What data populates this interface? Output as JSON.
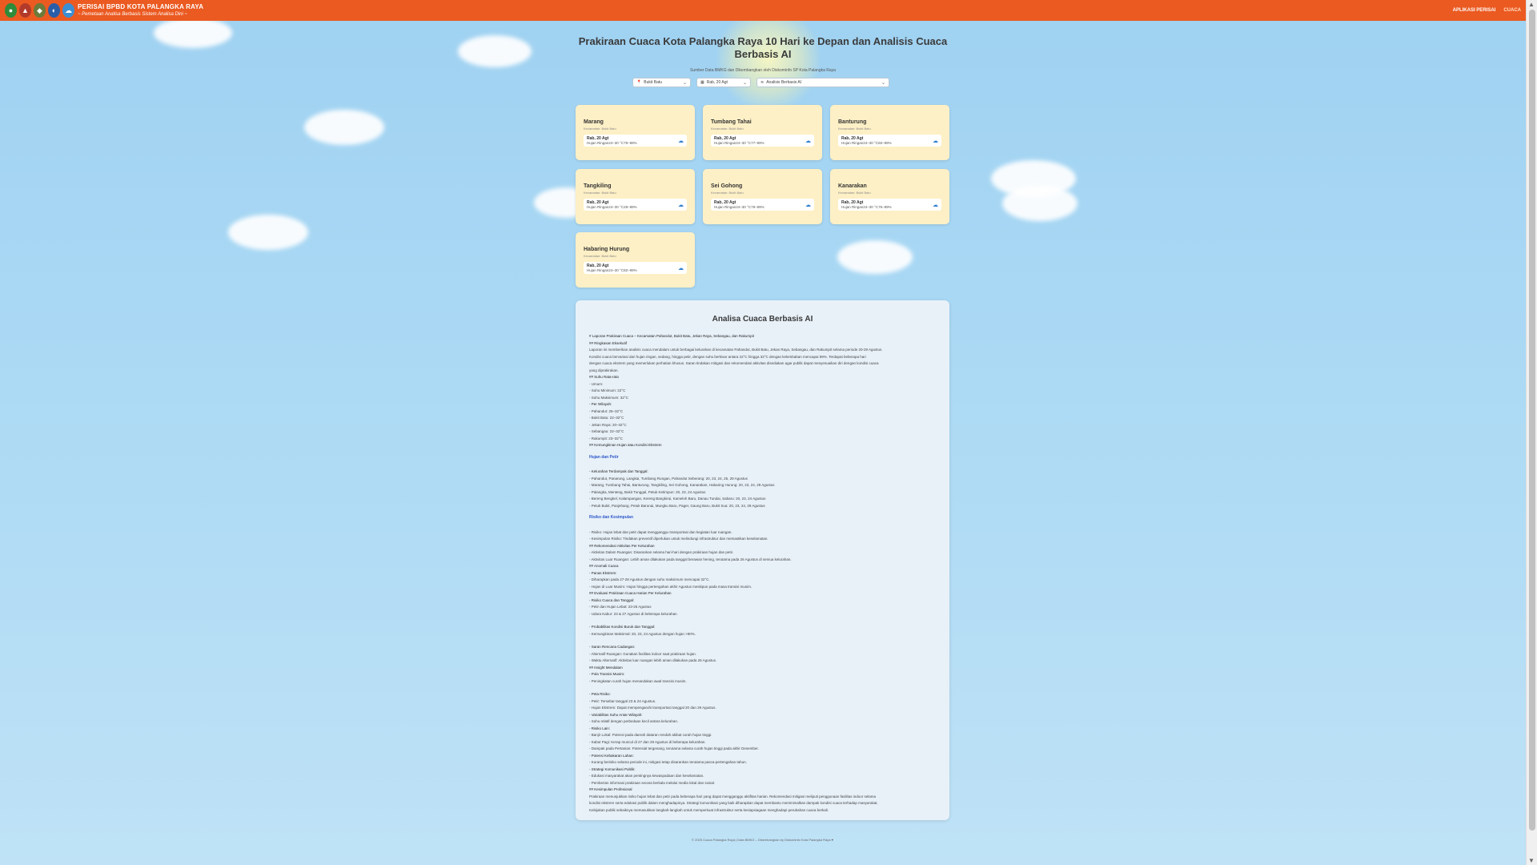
{
  "header": {
    "brand_title": "PERISAI BPBD KOTA PALANGKA RAYA",
    "brand_subtitle": "~ Pemetaan Analisa Berbasis Sistem Analisa Dini ~",
    "nav": [
      "APLIKASI PERISAI",
      "CUACA"
    ],
    "accent": "#eb5a21"
  },
  "main": {
    "title": "Prakiraan Cuaca Kota Palangka Raya 10 Hari ke Depan dan Analisis Cuaca Berbasis AI",
    "subtitle": "Sumber Data BMKG dan Dikembangkan oleh Diskominfo SP Kota Palangka Raya"
  },
  "filters": {
    "location": "Bukit Batu",
    "date": "Rab, 20 Agt",
    "mode": "Analisis Berbasis AI"
  },
  "cards": [
    {
      "name": "Marang",
      "kecamatan": "Kecamatan: Bukit Batu",
      "date": "Rab, 20 Agt",
      "desc": "Hujan Ringan24–30 °C79–99%"
    },
    {
      "name": "Tumbang Tahai",
      "kecamatan": "Kecamatan: Bukit Batu",
      "date": "Rab, 20 Agt",
      "desc": "Hujan Ringan24–30 °C77–99%"
    },
    {
      "name": "Banturung",
      "kecamatan": "Kecamatan: Bukit Batu",
      "date": "Rab, 20 Agt",
      "desc": "Hujan Ringan24–30 °C60–99%"
    },
    {
      "name": "Tangkiling",
      "kecamatan": "Kecamatan: Bukit Batu",
      "date": "Rab, 20 Agt",
      "desc": "Hujan Ringan24–30 °C28–99%"
    },
    {
      "name": "Sei Gohong",
      "kecamatan": "Kecamatan: Bukit Batu",
      "date": "Rab, 20 Agt",
      "desc": "Hujan Ringan24–30 °C79–99%"
    },
    {
      "name": "Kanarakan",
      "kecamatan": "Kecamatan: Bukit Batu",
      "date": "Rab, 20 Agt",
      "desc": "Hujan Ringan24–30 °C76–99%"
    },
    {
      "name": "Habaring Hurung",
      "kecamatan": "Kecamatan: Bukit Batu",
      "date": "Rab, 20 Agt",
      "desc": "Hujan Ringan24–30 °C82–99%"
    }
  ],
  "analysis": {
    "title": "Analisa Cuaca Berbasis AI",
    "lines": [
      {
        "t": "# Laporan Prakiraan Cuaca – Kecamatan Pahandut, Bukit Batu, Jekan Raya, Sebangau, dan Rakumpit",
        "c": "h"
      },
      {
        "t": "## Ringkasan Eksekutif",
        "c": "h"
      },
      {
        "t": "Laporan ini memberikan analisis cuaca mendalam untuk berbagai kelurahan di kecamatan Pahandut, Bukit Batu, Jekan Raya, Sebangau, dan Rakumpit selama periode 20-29 Agustus.",
        "c": ""
      },
      {
        "t": "Kondisi cuaca bervariasi dari hujan ringan, sedang, hingga petir, dengan suhu berkisar antara 22°C hingga 32°C dengan kelembaban mencapai 99%. Terdapat beberapa hari",
        "c": ""
      },
      {
        "t": "dengan cuaca ekstrem yang memerlukan perhatian khusus. Saran tindakan mitigasi dan rekomendasi aktivitas disediakan agar publik dapat menyesuaikan diri dengan kondisi cuaca",
        "c": ""
      },
      {
        "t": "yang diprakirakan.",
        "c": ""
      },
      {
        "t": "## Suhu Rata-rata",
        "c": "h"
      },
      {
        "t": "- Umum:",
        "c": ""
      },
      {
        "t": "  - Suhu Minimum: 22°C",
        "c": ""
      },
      {
        "t": "  - Suhu Maksimum: 32°C",
        "c": ""
      },
      {
        "t": "- Per Wilayah:",
        "c": "h"
      },
      {
        "t": "  - Pahandut: 25–32°C",
        "c": ""
      },
      {
        "t": "  - Bukit Batu: 22–32°C",
        "c": ""
      },
      {
        "t": "  - Jekan Raya: 20–32°C",
        "c": ""
      },
      {
        "t": "  - Sebangau: 22–32°C",
        "c": ""
      },
      {
        "t": "  - Rakumpit: 23–32°C",
        "c": ""
      },
      {
        "t": "## Kemungkinan Hujan atau Kondisi Ekstrem",
        "c": "h"
      },
      {
        "t": "Hujan dan Petir",
        "c": "blue"
      },
      {
        "t": "- Kelurahan Terdampak dan Tanggal:",
        "c": "h"
      },
      {
        "t": "  - Pahandut, Panarung, Langkai, Tumbang Rungan, Pahandut Seberang: 20, 23, 24, 25, 29 Agustus",
        "c": ""
      },
      {
        "t": "  - Marang, Tumbang Tahai, Banturung, Tangkiling, Sei Gohong, Kanarakan, Habaring Hurung: 20, 23, 24, 29 Agustus",
        "c": ""
      },
      {
        "t": "  - Palangka, Menteng, Bukit Tunggal, Petuk Ketimpun: 20, 23, 24 Agustus",
        "c": ""
      },
      {
        "t": "  - Bereng Bengkel, Kalampangan, Kereng Bangkirai, Kameloh Baru, Danau Tundai, Sabaru: 20, 23, 24 Agustus",
        "c": ""
      },
      {
        "t": "  - Petuk Bukit, Panjehang, Petuk Barunai, Mungku Baru, Pager, Gaung Baru, Bukit Sua: 20, 23, 24, 29 Agustus",
        "c": ""
      },
      {
        "t": "Risiko dan Kesimpulan",
        "c": "blue"
      },
      {
        "t": "- Risiko: Hujan lebat dan petir dapat mengganggu transportasi dan kegiatan luar ruangan.",
        "c": ""
      },
      {
        "t": "- Kesimpulan Risiko: Tindakan preventif diperlukan untuk melindungi infrastruktur dan memastikan keselamatan.",
        "c": ""
      },
      {
        "t": "## Rekomendasi Aktivitas Per Kelurahan",
        "c": "h"
      },
      {
        "t": "- Aktivitas Dalam Ruangan: Disarankan selama hari-hari dengan prakiraan hujan dan petir.",
        "c": ""
      },
      {
        "t": "- Aktivitas Luar Ruangan: Lebih aman dilakukan pada tanggal berawan hening, terutama pada 26 Agustus di semua kelurahan.",
        "c": ""
      },
      {
        "t": "## Anomali Cuaca",
        "c": "h"
      },
      {
        "t": "- Panas Ekstrem:",
        "c": "h"
      },
      {
        "t": "  - Diharapkan pada 27-28 Agustus dengan suhu maksimum mencapai 32°C.",
        "c": ""
      },
      {
        "t": "- Hujan di Luar Musim: Hujan hingga pertengahan akhir Agustus meskipun pada masa transisi musim.",
        "c": ""
      },
      {
        "t": "## Evaluasi Prakiraan Cuaca Harian Per Kelurahan",
        "c": "h"
      },
      {
        "t": "- Risiko Cuaca dan Tanggal:",
        "c": "h"
      },
      {
        "t": "  - Petir dan Hujan Lebat: 23-25 Agustus",
        "c": ""
      },
      {
        "t": "  - Udara Kabur: 23 & 27 Agustus di beberapa kelurahan",
        "c": ""
      },
      {
        "t": "",
        "c": "gap"
      },
      {
        "t": "- Probabilitas Kondisi Buruk dan Tanggal:",
        "c": "h"
      },
      {
        "t": "  - Kemungkinan Maksimal: 20, 23, 24 Agustus dengan hujan >90%.",
        "c": ""
      },
      {
        "t": "",
        "c": "gap"
      },
      {
        "t": "- Saran Rencana Cadangan:",
        "c": "h"
      },
      {
        "t": "  - Alternatif Ruangan: Gunakan fasilitas indoor saat prakiraan hujan.",
        "c": ""
      },
      {
        "t": "  - Waktu Alternatif: Aktivitas luar ruangan lebih aman dilakukan pada 26 Agustus.",
        "c": ""
      },
      {
        "t": "## Insight Mendalam",
        "c": "h"
      },
      {
        "t": "- Pola Transisi Musim:",
        "c": "h"
      },
      {
        "t": "  - Peningkatan curah hujan menandakan awal transisi musim.",
        "c": ""
      },
      {
        "t": "",
        "c": "gap"
      },
      {
        "t": "- Peta Risiko:",
        "c": "h"
      },
      {
        "t": "  - Petir: Tersebar tanggal 23 & 24 Agustus.",
        "c": ""
      },
      {
        "t": "  - Hujan Ekstrem: Dapat mempengaruhi transportasi tanggal 20 dan 29 Agustus.",
        "c": ""
      },
      {
        "t": "- Variabilitas Suhu Antar Wilayah:",
        "c": "h"
      },
      {
        "t": "  - Suhu relatif dengan perbedaan kecil antara kelurahan.",
        "c": ""
      },
      {
        "t": "- Risiko Lain:",
        "c": "h"
      },
      {
        "t": "  - Banjir Lokal: Potensi pada daerah dataran rendah akibat curah hujan tinggi.",
        "c": ""
      },
      {
        "t": "  - Kabut Pagi: Kerap muncul di 27 dan 29 Agustus di beberapa kelurahan.",
        "c": ""
      },
      {
        "t": "  - Dampak pada Pertanian: Potensial tergenang, terutama selama curah hujan tinggi pada akhir Desember.",
        "c": ""
      },
      {
        "t": "- Potensi Kebakaran Lahan:",
        "c": "h"
      },
      {
        "t": "  - Kurang berisiko selama periode ini, mitigasi tetap disarankan terutama pasca-pertengahan tahun.",
        "c": ""
      },
      {
        "t": "- Strategi Komunikasi Publik:",
        "c": "h"
      },
      {
        "t": "  - Edukasi masyarakat akan pentingnya kewaspadaan dan keselamatan.",
        "c": ""
      },
      {
        "t": "  - Pemberian informasi prakiraan secara berkala melalui media lokal dan sosial.",
        "c": ""
      },
      {
        "t": "## Kesimpulan Profesional",
        "c": "h"
      },
      {
        "t": "Prakiraan menunjukkan risiko hujan lebat dan petir pada beberapa hari yang dapat mengganggu aktifitas harian. Rekomendasi mitigasi meliputi penggunaan fasilitas indoor selama",
        "c": ""
      },
      {
        "t": "kondisi ekstrem serta edukasi publik dalam menghadapinya. Strategi komunikasi yang baik diharapkan dapat membantu meminimalkan dampak kondisi cuaca terhadap masyarakat.",
        "c": ""
      },
      {
        "t": "Kebijakan publik sebaiknya memasukkan langkah-langkah untuk memperkuat infrastruktur serta kesiapsiagaan menghadapi perubahan cuaca berkali.",
        "c": ""
      }
    ]
  },
  "footer": "© 2025 Cuaca Palangka Raya | Data BMKG – Dikembangkan by Diskominfo Kota Palangka Raya ♥"
}
